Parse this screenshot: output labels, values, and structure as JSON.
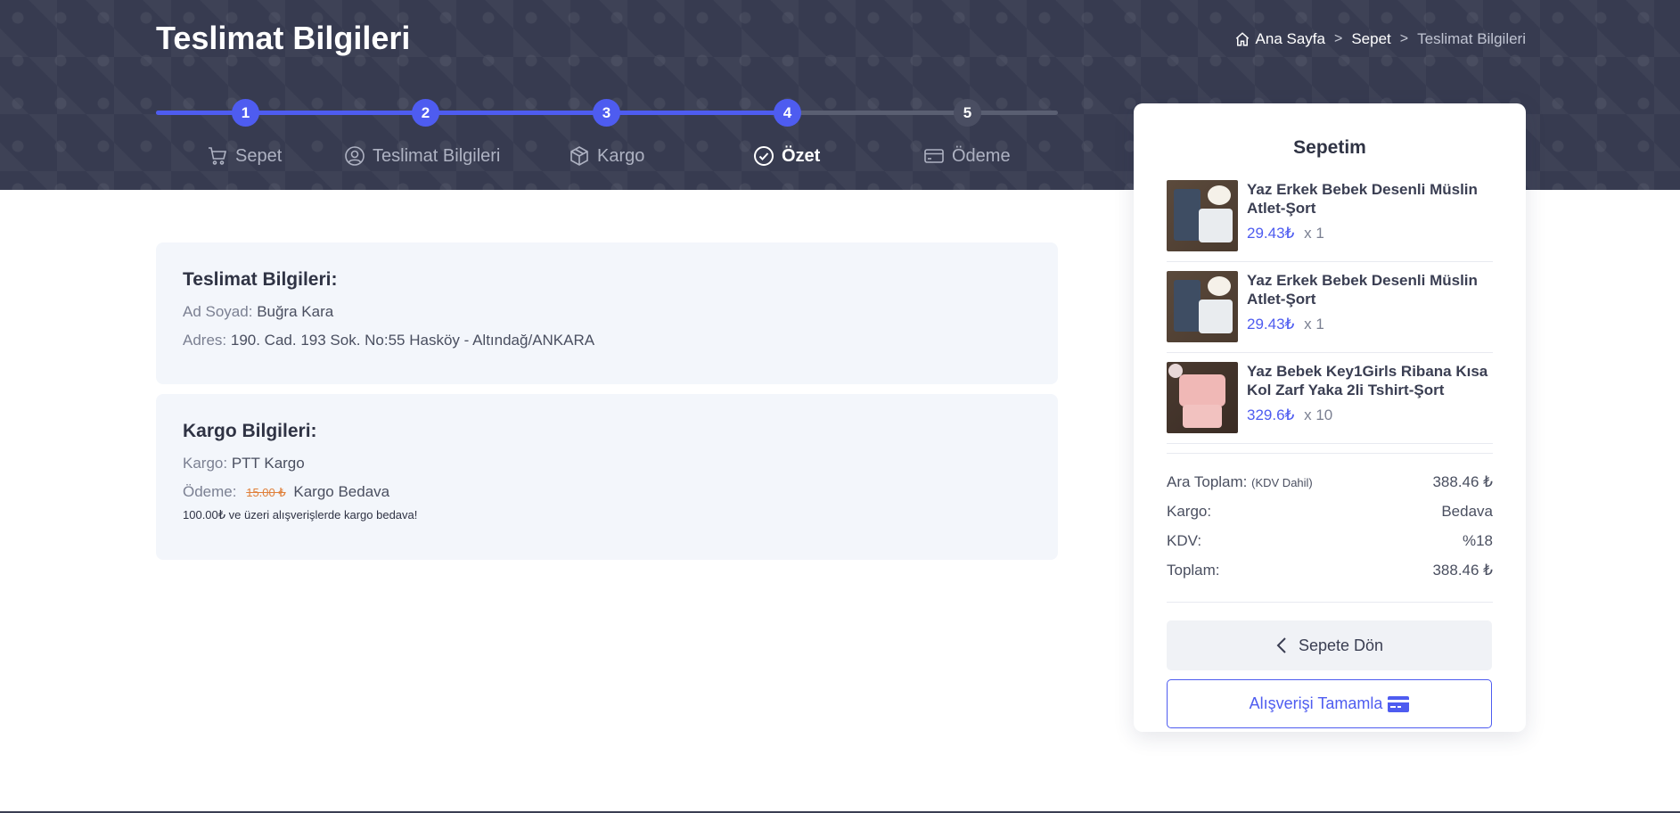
{
  "header": {
    "title": "Teslimat Bilgileri",
    "breadcrumb": {
      "home": "Ana Sayfa",
      "cart": "Sepet",
      "current": "Teslimat Bilgileri",
      "separator": ">"
    }
  },
  "steps": {
    "progress_percent": 70,
    "items": [
      {
        "number": "1",
        "label": "Sepet",
        "icon": "cart-icon",
        "status": "done"
      },
      {
        "number": "2",
        "label": "Teslimat Bilgileri",
        "icon": "user-icon",
        "status": "done"
      },
      {
        "number": "3",
        "label": "Kargo",
        "icon": "box-icon",
        "status": "done"
      },
      {
        "number": "4",
        "label": "Özet",
        "icon": "check-circle-icon",
        "status": "active"
      },
      {
        "number": "5",
        "label": "Ödeme",
        "icon": "credit-card-icon",
        "status": "todo"
      }
    ]
  },
  "delivery": {
    "title": "Teslimat Bilgileri:",
    "name_label": "Ad Soyad:",
    "name_value": "Buğra Kara",
    "address_label": "Adres:",
    "address_value": "190. Cad. 193 Sok. No:55 Hasköy - Altındağ/ANKARA"
  },
  "shipping": {
    "title": "Kargo Bilgileri:",
    "carrier_label": "Kargo:",
    "carrier_value": "PTT Kargo",
    "payment_label": "Ödeme:",
    "old_price": "15.00 ₺",
    "payment_value": "Kargo Bedava",
    "note": "100.00₺ ve üzeri alışverişlerde kargo bedava!"
  },
  "cart": {
    "title": "Sepetim",
    "items": [
      {
        "name": "Yaz Erkek Bebek Desenli Müslin Atlet-Şort",
        "price": "29.43₺",
        "qty": "x 1",
        "thumb": "blue"
      },
      {
        "name": "Yaz Erkek Bebek Desenli Müslin Atlet-Şort",
        "price": "29.43₺",
        "qty": "x 1",
        "thumb": "blue"
      },
      {
        "name": "Yaz Bebek Key1Girls Ribana Kısa Kol Zarf Yaka 2li Tshirt-Şort",
        "price": "329.6₺",
        "qty": "x 10",
        "thumb": "pink"
      }
    ],
    "totals": {
      "subtotal_label": "Ara Toplam:",
      "subtotal_note": "(KDV Dahil)",
      "subtotal_value": "388.46 ₺",
      "shipping_label": "Kargo:",
      "shipping_value": "Bedava",
      "tax_label": "KDV:",
      "tax_value": "%18",
      "total_label": "Toplam:",
      "total_value": "388.46 ₺"
    },
    "back_button": "Sepete Dön",
    "complete_button": "Alışverişi Tamamla"
  },
  "colors": {
    "accent": "#4e5cf0",
    "hero_bg": "#373b50",
    "card_bg": "#f3f6fb",
    "strike": "#e0803a"
  }
}
